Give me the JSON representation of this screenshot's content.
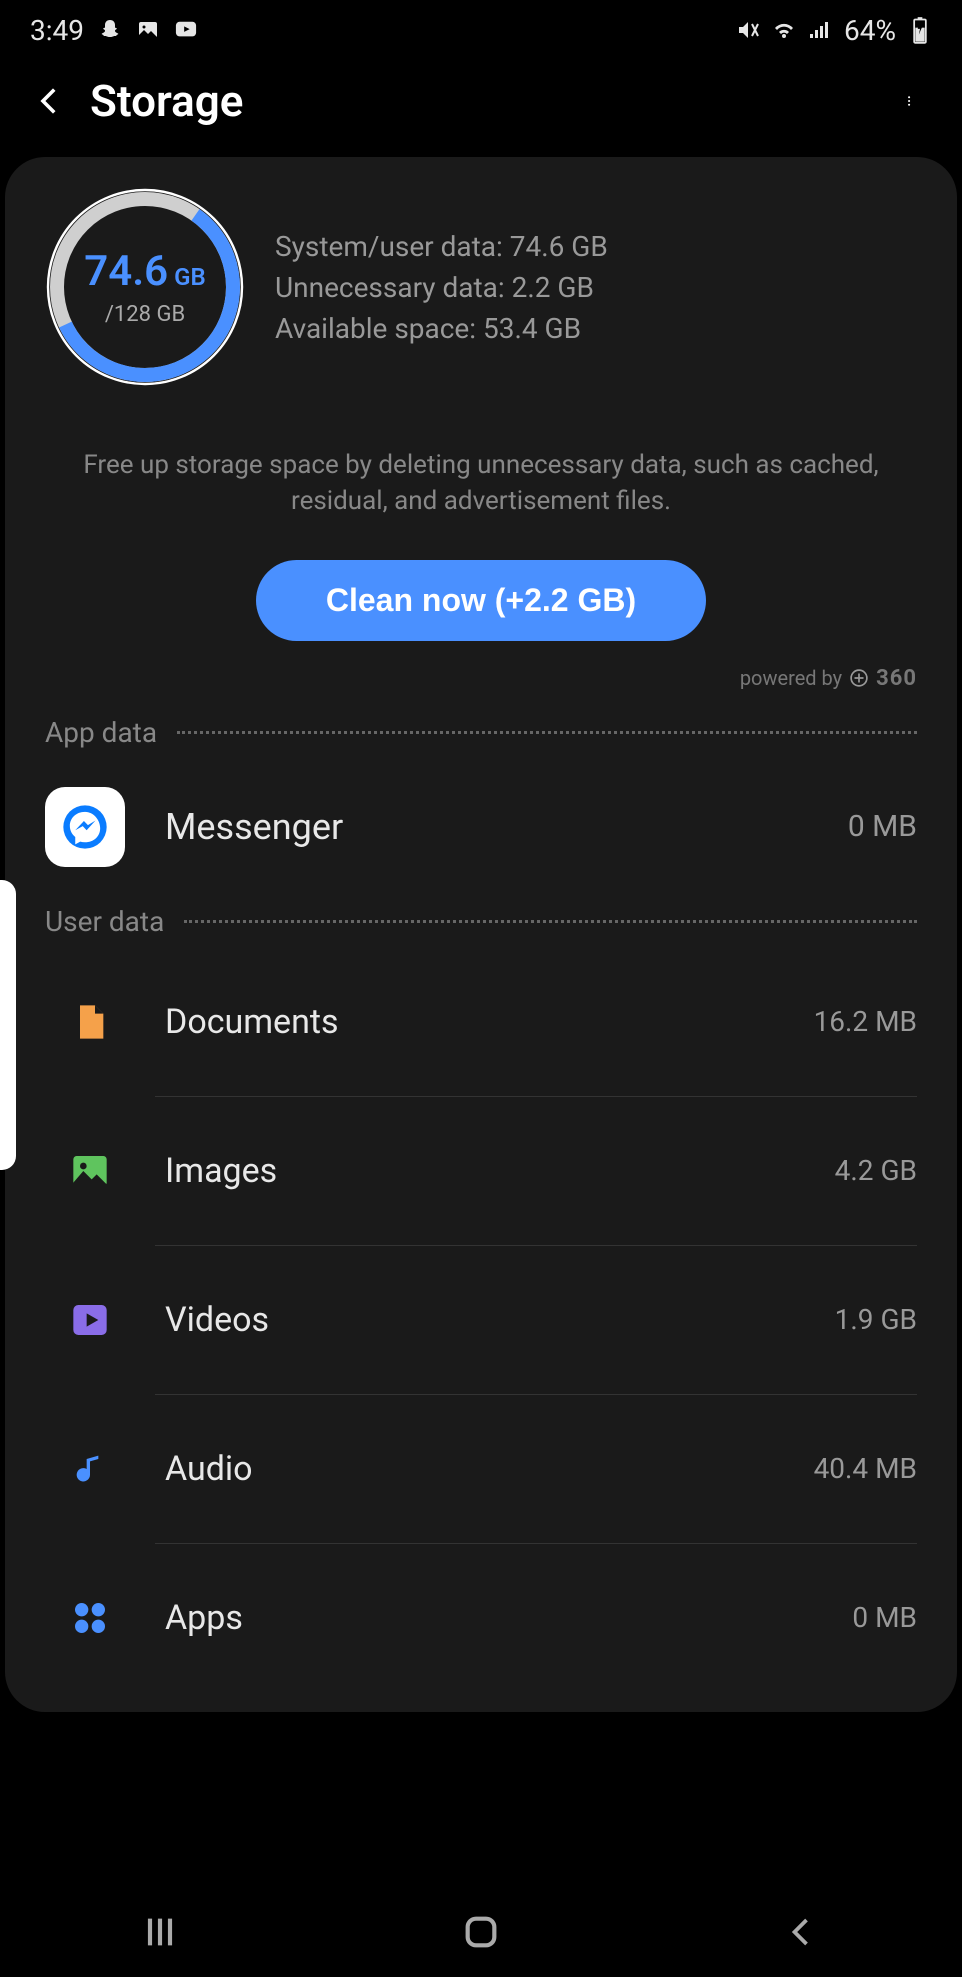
{
  "status": {
    "time": "3:49",
    "battery": "64%"
  },
  "header": {
    "title": "Storage"
  },
  "summary": {
    "used_value": "74.6",
    "used_unit": "GB",
    "total": "/128 GB",
    "line1": "System/user data: 74.6 GB",
    "line2": "Unnecessary data: 2.2 GB",
    "line3": "Available space: 53.4 GB"
  },
  "hint": "Free up storage space by deleting unnecessary data, such as cached, residual, and advertisement files.",
  "clean_button": "Clean now (+2.2 GB)",
  "powered_by_label": "powered by",
  "powered_by_brand": "360",
  "sections": {
    "app_data": "App data",
    "user_data": "User data"
  },
  "app_rows": [
    {
      "name": "Messenger",
      "size": "0 MB"
    }
  ],
  "user_rows": [
    {
      "name": "Documents",
      "size": "16.2 MB",
      "icon": "document",
      "color": "#f5a14a"
    },
    {
      "name": "Images",
      "size": "4.2 GB",
      "icon": "image",
      "color": "#5fc45e"
    },
    {
      "name": "Videos",
      "size": "1.9 GB",
      "icon": "video",
      "color": "#8a6de8"
    },
    {
      "name": "Audio",
      "size": "40.4 MB",
      "icon": "audio",
      "color": "#4a90ff"
    },
    {
      "name": "Apps",
      "size": "0 MB",
      "icon": "apps",
      "color": "#4a90ff"
    }
  ],
  "chart_data": {
    "type": "pie",
    "title": "Storage usage ring",
    "total_gb": 128,
    "used_gb": 74.6,
    "series": [
      {
        "name": "Used (system/user data)",
        "value_gb": 74.6,
        "color": "#4a90ff"
      },
      {
        "name": "Available",
        "value_gb": 53.4,
        "color": "#cfcfcf"
      }
    ]
  }
}
